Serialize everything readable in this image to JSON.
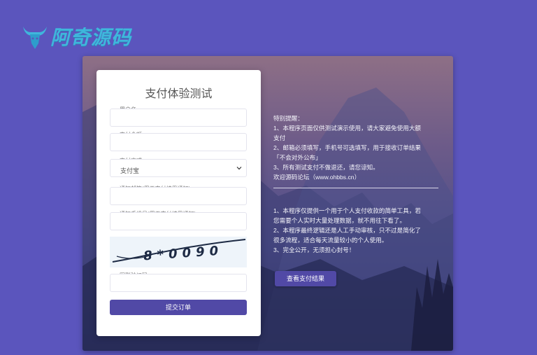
{
  "logo": {
    "text": "阿奇源码"
  },
  "form": {
    "title": "支付体验测试",
    "username_label": "用户名",
    "amount_label": "支付金额",
    "method_label": "支付方式",
    "method_value": "支付宝",
    "email_label": "通知邮箱(用于支付结果通知)",
    "phone_label": "通知手机号(用于支付结果通知)",
    "captcha_text": "8*0090",
    "captcha_code_label": "图形验证码",
    "submit_label": "提交订单"
  },
  "notice": {
    "heading": "特别提醒：",
    "lines_top": [
      "1、本程序页面仅供测试演示使用，请大家避免使用大额",
      "支付",
      "2、邮箱必须填写，手机号可选填写，用于接收订单结果",
      "「不会对外公布」",
      "3、所有测试支付不做退还，请您谅知。",
      "欢迎源码论坛（www.ohbbs.cn）"
    ],
    "lines_bottom": [
      "1、本程序仅提供一个用于个人支付收款的简单工具，若",
      "您需要个人实时大量处理数据，就不用往下看了。",
      "2、本程序最终逻辑还是人工手动审核，只不过是简化了",
      "很多流程，适合每天流量较小的个人使用。",
      "3、完全公开，无须担心封号！"
    ],
    "check_button": "查看支付结果"
  },
  "colors": {
    "background": "#5b55bd",
    "button": "#5149a6",
    "logo": "#3fb6dc"
  }
}
